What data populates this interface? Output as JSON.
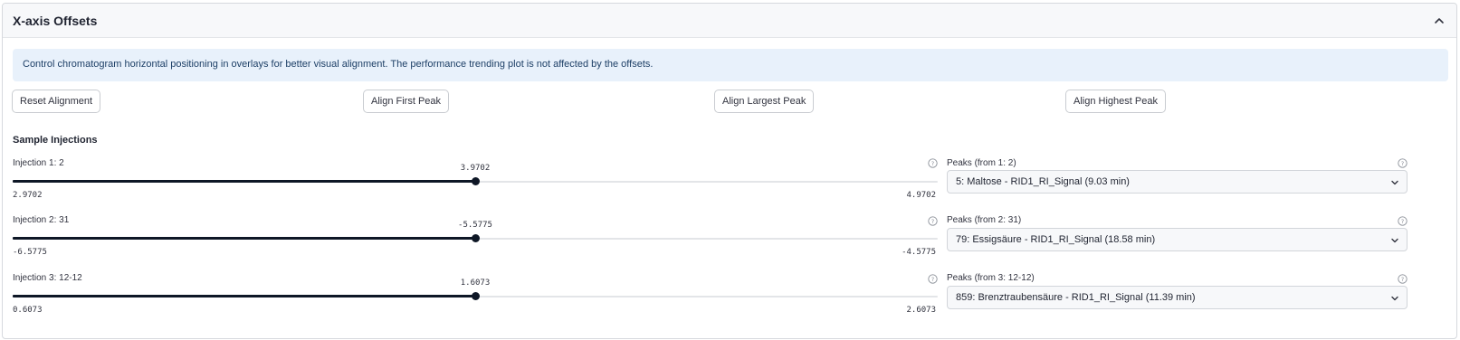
{
  "header": {
    "title": "X-axis Offsets",
    "collapse_icon": "chevron-up-icon"
  },
  "info": {
    "text": "Control chromatogram horizontal positioning in overlays for better visual alignment. The performance trending plot is not affected by the offsets."
  },
  "buttons": {
    "reset": "Reset Alignment",
    "first": "Align First Peak",
    "largest": "Align Largest Peak",
    "highest": "Align Highest Peak"
  },
  "section": {
    "title": "Sample Injections"
  },
  "injections": [
    {
      "label": "Injection 1: 2",
      "value": "3.9702",
      "min": "2.9702",
      "max": "4.9702",
      "peaks_label": "Peaks (from 1: 2)",
      "peak_selected": "5: Maltose - RID1_RI_Signal (9.03 min)"
    },
    {
      "label": "Injection 2: 31",
      "value": "-5.5775",
      "min": "-6.5775",
      "max": "-4.5775",
      "peaks_label": "Peaks (from 2: 31)",
      "peak_selected": "79: Essigsäure - RID1_RI_Signal (18.58 min)"
    },
    {
      "label": "Injection 3: 12-12",
      "value": "1.6073",
      "min": "0.6073",
      "max": "2.6073",
      "peaks_label": "Peaks (from 3: 12-12)",
      "peak_selected": "859: Brenztraubensäure - RID1_RI_Signal (11.39 min)"
    }
  ],
  "colors": {
    "accent": "#0e1726",
    "info_bg": "#e8f1fb",
    "info_text": "#1d3f66"
  }
}
